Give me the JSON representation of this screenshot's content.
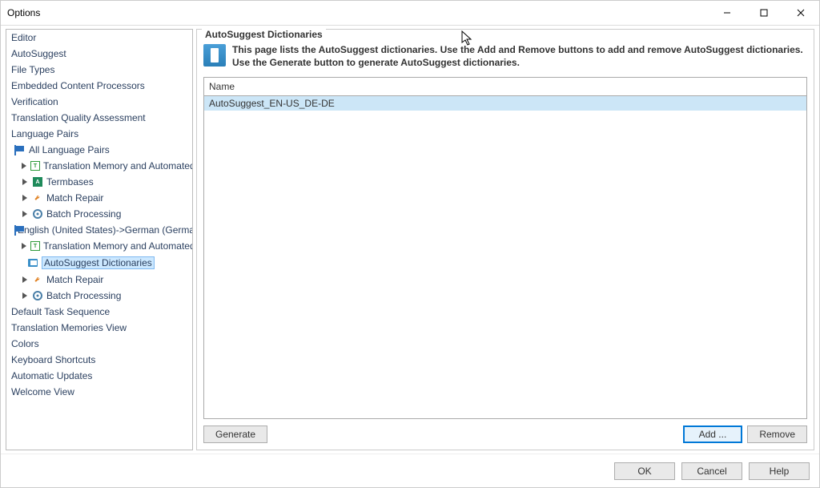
{
  "window": {
    "title": "Options"
  },
  "sidebar": {
    "editor": "Editor",
    "autosuggest": "AutoSuggest",
    "file_types": "File Types",
    "embedded": "Embedded Content Processors",
    "verification": "Verification",
    "tqa": "Translation Quality Assessment",
    "language_pairs": "Language Pairs",
    "all_language_pairs": "All Language Pairs",
    "tm_auto": "Translation Memory and Automated",
    "termbases": "Termbases",
    "match_repair": "Match Repair",
    "batch_processing": "Batch Processing",
    "lang_pair_en_de": "English (United States)->German (Germa",
    "tm_auto2": "Translation Memory and Automated",
    "autosuggest_dicts": "AutoSuggest Dictionaries",
    "match_repair2": "Match Repair",
    "batch_processing2": "Batch Processing",
    "default_task": "Default Task Sequence",
    "tm_view": "Translation Memories View",
    "colors": "Colors",
    "shortcuts": "Keyboard Shortcuts",
    "updates": "Automatic Updates",
    "welcome": "Welcome View"
  },
  "panel": {
    "title": "AutoSuggest Dictionaries",
    "info": "This page lists the AutoSuggest dictionaries. Use the Add and Remove buttons to add and remove AutoSuggest dictionaries. Use the Generate button to generate AutoSuggest dictionaries.",
    "column_name": "Name",
    "rows": [
      {
        "name": "AutoSuggest_EN-US_DE-DE"
      }
    ],
    "buttons": {
      "generate": "Generate",
      "add": "Add ...",
      "remove": "Remove"
    }
  },
  "footer": {
    "ok": "OK",
    "cancel": "Cancel",
    "help": "Help"
  }
}
